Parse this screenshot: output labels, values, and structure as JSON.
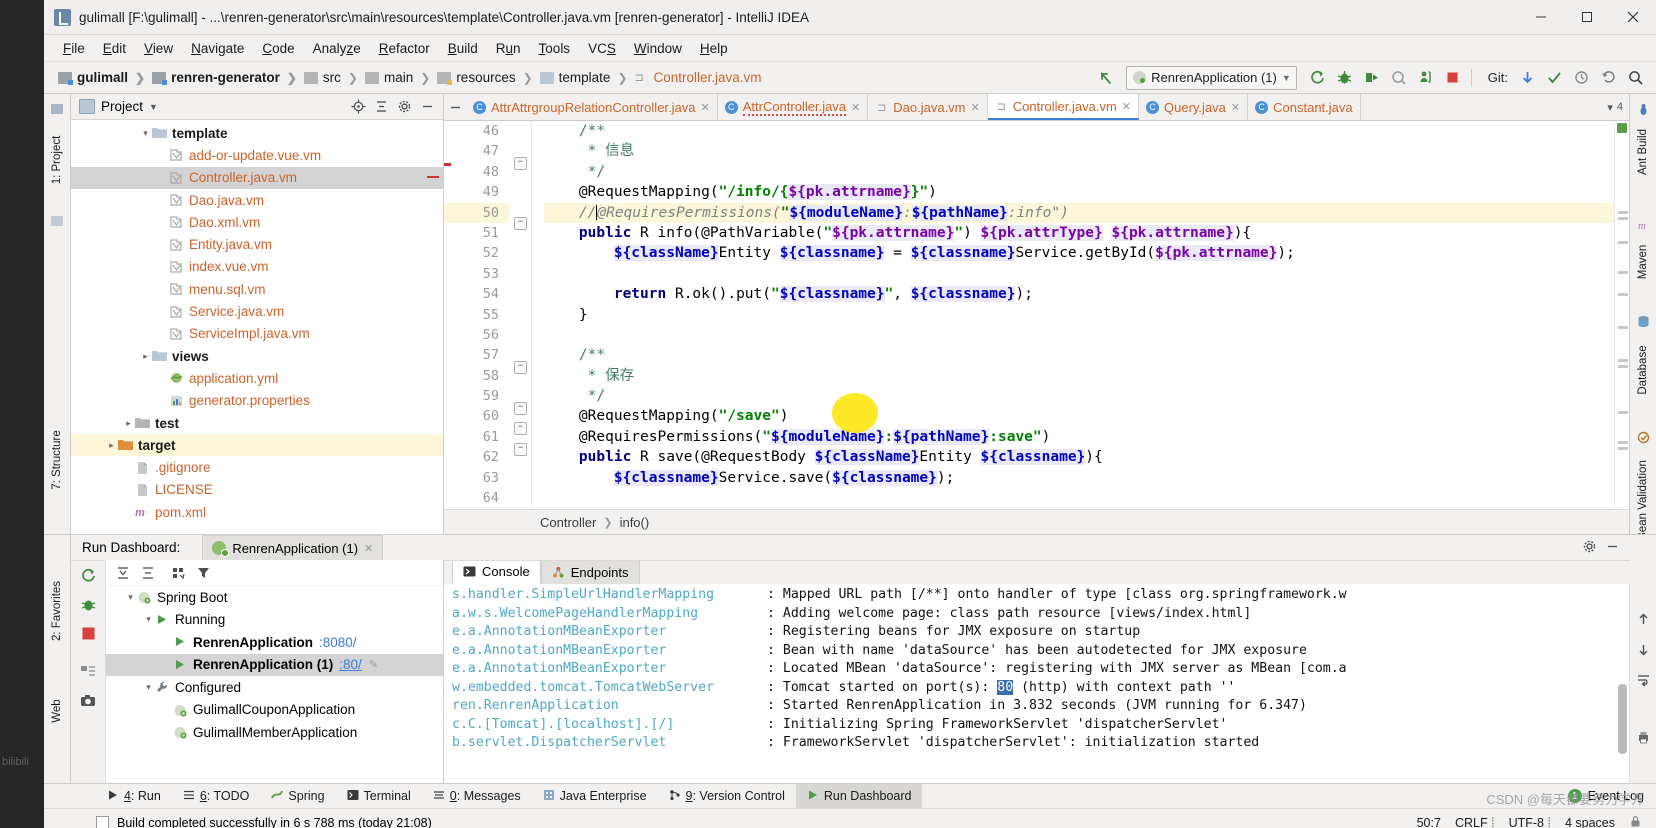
{
  "window": {
    "title": "gulimall [F:\\gulimall] - ...\\renren-generator\\src\\main\\resources\\template\\Controller.java.vm [renren-generator] - IntelliJ IDEA",
    "minimize_label": "Minimize",
    "maximize_label": "Maximize",
    "close_label": "Close"
  },
  "menu": [
    "File",
    "Edit",
    "View",
    "Navigate",
    "Code",
    "Analyze",
    "Refactor",
    "Build",
    "Run",
    "Tools",
    "VCS",
    "Window",
    "Help"
  ],
  "breadcrumbs": [
    {
      "label": "gulimall",
      "icon": "module-icon",
      "bold": true
    },
    {
      "label": "renren-generator",
      "icon": "module-icon",
      "bold": true
    },
    {
      "label": "src",
      "icon": "folder-icon",
      "bold": false
    },
    {
      "label": "main",
      "icon": "folder-icon",
      "bold": false
    },
    {
      "label": "resources",
      "icon": "resources-folder-icon",
      "bold": false
    },
    {
      "label": "template",
      "icon": "folder-icon",
      "bold": false
    },
    {
      "label": "Controller.java.vm",
      "icon": "velocity-file-icon",
      "bold": false
    }
  ],
  "toolbar": {
    "run_config": "RenrenApplication (1)",
    "git_label": "Git:",
    "icons": [
      "back-arrow-icon",
      "rerun-icon",
      "debug-icon",
      "run-with-coverage-icon",
      "profile-icon",
      "attach-icon",
      "stop-icon",
      "update-project-icon",
      "commit-icon",
      "history-icon",
      "rollback-icon",
      "search-everywhere-icon"
    ]
  },
  "project_panel": {
    "title": "Project",
    "actions": [
      "locate-icon",
      "collapse-all-icon",
      "settings-icon",
      "hide-icon"
    ],
    "tree": [
      {
        "label": "template",
        "indent": 4,
        "icon": "folder-template-icon",
        "arrow": "down",
        "color": "dark"
      },
      {
        "label": "add-or-update.vue.vm",
        "indent": 5,
        "icon": "velocity-file-icon",
        "arrow": "",
        "color": "orange"
      },
      {
        "label": "Controller.java.vm",
        "indent": 5,
        "icon": "velocity-file-icon",
        "arrow": "",
        "color": "orange",
        "selected": true
      },
      {
        "label": "Dao.java.vm",
        "indent": 5,
        "icon": "velocity-file-icon",
        "arrow": "",
        "color": "orange"
      },
      {
        "label": "Dao.xml.vm",
        "indent": 5,
        "icon": "velocity-file-icon",
        "arrow": "",
        "color": "orange"
      },
      {
        "label": "Entity.java.vm",
        "indent": 5,
        "icon": "velocity-file-icon",
        "arrow": "",
        "color": "orange"
      },
      {
        "label": "index.vue.vm",
        "indent": 5,
        "icon": "velocity-file-icon",
        "arrow": "",
        "color": "orange"
      },
      {
        "label": "menu.sql.vm",
        "indent": 5,
        "icon": "velocity-file-icon",
        "arrow": "",
        "color": "orange"
      },
      {
        "label": "Service.java.vm",
        "indent": 5,
        "icon": "velocity-file-icon",
        "arrow": "",
        "color": "orange"
      },
      {
        "label": "ServiceImpl.java.vm",
        "indent": 5,
        "icon": "velocity-file-icon",
        "arrow": "",
        "color": "orange"
      },
      {
        "label": "views",
        "indent": 4,
        "icon": "folder-template-icon",
        "arrow": "right",
        "color": "dark"
      },
      {
        "label": "application.yml",
        "indent": 5,
        "icon": "yaml-file-icon",
        "arrow": "",
        "color": "orange"
      },
      {
        "label": "generator.properties",
        "indent": 5,
        "icon": "properties-file-icon",
        "arrow": "",
        "color": "orange"
      },
      {
        "label": "test",
        "indent": 3,
        "icon": "folder-icon",
        "arrow": "right",
        "color": "dark"
      },
      {
        "label": "target",
        "indent": 2,
        "icon": "folder-orange-icon",
        "arrow": "right",
        "color": "dark",
        "highlight": true
      },
      {
        "label": ".gitignore",
        "indent": 3,
        "icon": "git-file-icon",
        "arrow": "",
        "color": "orange"
      },
      {
        "label": "LICENSE",
        "indent": 3,
        "icon": "git-file-icon",
        "arrow": "",
        "color": "orange"
      },
      {
        "label": "pom.xml",
        "indent": 3,
        "icon": "maven-file-icon",
        "arrow": "",
        "color": "orange"
      }
    ]
  },
  "editor_tabs": [
    {
      "label": "AttrAttrgroupRelationController.java",
      "icon": "java-class-icon",
      "active": false,
      "closable": true
    },
    {
      "label": "AttrController.java",
      "icon": "java-class-icon",
      "active": false,
      "closable": true,
      "error": true
    },
    {
      "label": "Dao.java.vm",
      "icon": "velocity-file-icon",
      "active": false,
      "closable": true
    },
    {
      "label": "Controller.java.vm",
      "icon": "velocity-file-icon",
      "active": true,
      "closable": true
    },
    {
      "label": "Query.java",
      "icon": "java-class-icon",
      "active": false,
      "closable": true
    },
    {
      "label": "Constant.java",
      "icon": "java-class-icon",
      "active": false,
      "closable": false
    }
  ],
  "tab_overflow": "4",
  "code": {
    "first_line": 46,
    "highlight_line": 50,
    "lines": [
      {
        "n": 46,
        "html": "    <span class=\"cmt2\">/**</span>"
      },
      {
        "n": 47,
        "html": "     <span class=\"cmt2\">* 信息</span>"
      },
      {
        "n": 48,
        "html": "     <span class=\"cmt2\">*/</span>"
      },
      {
        "n": 49,
        "html": "    <span class=\"pl\">@RequestMapping(</span><span class=\"str\">\"/info/{</span><span class=\"varp\">${pk.attrname}</span><span class=\"str\">}\"</span><span class=\"pl\">)</span>"
      },
      {
        "n": 50,
        "html": "    <span class=\"cmt\">//</span><span class=\"caret\"></span><span class=\"cmt\">@RequiresPermissions(</span><span class=\"str\">\"</span><span class=\"var\">${moduleName}</span><span class=\"cmt\">:</span><span class=\"var\">${pathName}</span><span class=\"cmt\">:info\"</span><span class=\"cmt\">)</span>"
      },
      {
        "n": 51,
        "html": "    <span class=\"kw\">public</span> <span class=\"pl\">R info(@PathVariable(</span><span class=\"str\">\"</span><span class=\"varp\">${pk.attrname}</span><span class=\"str\">\"</span><span class=\"pl\">) </span><span class=\"varp\">${pk.attrType}</span><span class=\"pl\"> </span><span class=\"varp\">${pk.attrname}</span><span class=\"pl\">){</span>"
      },
      {
        "n": 52,
        "html": "        <span class=\"var\">${className}</span><span class=\"pl\">Entity </span><span class=\"var\">${classname}</span><span class=\"pl\"> = </span><span class=\"var\">${classname}</span><span class=\"pl\">Service.getById(</span><span class=\"varp\">${pk.attrname}</span><span class=\"pl\">);</span>"
      },
      {
        "n": 53,
        "html": ""
      },
      {
        "n": 54,
        "html": "        <span class=\"kw\">return</span> <span class=\"pl\">R.ok().put(</span><span class=\"str\">\"</span><span class=\"var\">${classname}</span><span class=\"str\">\"</span><span class=\"pl\">, </span><span class=\"var\">${classname}</span><span class=\"pl\">);</span>"
      },
      {
        "n": 55,
        "html": "    <span class=\"pl\">}</span>"
      },
      {
        "n": 56,
        "html": ""
      },
      {
        "n": 57,
        "html": "    <span class=\"cmt2\">/**</span>"
      },
      {
        "n": 58,
        "html": "     <span class=\"cmt2\">* 保存</span>"
      },
      {
        "n": 59,
        "html": "     <span class=\"cmt2\">*/</span>"
      },
      {
        "n": 60,
        "html": "    <span class=\"pl\">@RequestMapping(</span><span class=\"str\">\"/save\"</span><span class=\"pl\">)</span>"
      },
      {
        "n": 61,
        "html": "    <span class=\"pl\">@RequiresPermissions(</span><span class=\"str\">\"</span><span class=\"var\">${moduleName}</span><span class=\"str\">:</span><span class=\"var\">${pathName}</span><span class=\"str\">:save\"</span><span class=\"pl\">)</span>"
      },
      {
        "n": 62,
        "html": "    <span class=\"kw\">public</span> <span class=\"pl\">R save(@RequestBody </span><span class=\"var\">${className}</span><span class=\"pl\">Entity </span><span class=\"var\">${classname}</span><span class=\"pl\">){</span>"
      },
      {
        "n": 63,
        "html": "        <span class=\"var\">${classname}</span><span class=\"pl\">Service.save(</span><span class=\"var\">${classname}</span><span class=\"pl\">);</span>"
      },
      {
        "n": 64,
        "html": ""
      }
    ]
  },
  "code_breadcrumb": [
    "Controller",
    "info()"
  ],
  "run_dashboard": {
    "title": "Run Dashboard:",
    "tab": "RenrenApplication (1)",
    "toolbar_icons": [
      "rerun-icon",
      "expand-all-icon",
      "collapse-all-icon",
      "group-icon",
      "filter-icon"
    ],
    "side_icons": [
      "rerun-icon",
      "debug-icon",
      "stop-icon",
      "show-services-icon",
      "screenshot-icon"
    ],
    "tree": [
      {
        "label": "Spring Boot",
        "indent": 1,
        "arrow": "down",
        "icon": "spring-boot-icon"
      },
      {
        "label": "Running",
        "indent": 2,
        "arrow": "down",
        "icon": "running-icon"
      },
      {
        "label": "RenrenApplication",
        "port": ":8080/",
        "indent": 3,
        "arrow": "",
        "icon": "run-icon",
        "bold": true
      },
      {
        "label": "RenrenApplication (1)",
        "port": ":80/",
        "indent": 3,
        "arrow": "",
        "icon": "run-icon",
        "bold": true,
        "selected": true,
        "edit": true
      },
      {
        "label": "Configured",
        "indent": 2,
        "arrow": "down",
        "icon": "wrench-icon"
      },
      {
        "label": "GulimallCouponApplication",
        "indent": 3,
        "arrow": "",
        "icon": "spring-boot-icon"
      },
      {
        "label": "GulimallMemberApplication",
        "indent": 3,
        "arrow": "",
        "icon": "spring-boot-icon"
      }
    ]
  },
  "console": {
    "tabs": [
      {
        "label": "Console",
        "icon": "console-icon",
        "active": true
      },
      {
        "label": "Endpoints",
        "icon": "endpoints-icon",
        "active": false
      }
    ],
    "lines": [
      {
        "cls": "s.handler.SimpleUrlHandlerMapping",
        "msg": ": Mapped URL path [/**] onto handler of type [class org.springframework.w"
      },
      {
        "cls": "a.w.s.WelcomePageHandlerMapping",
        "msg": ": Adding welcome page: class path resource [views/index.html]"
      },
      {
        "cls": "e.a.AnnotationMBeanExporter",
        "msg": ": Registering beans for JMX exposure on startup"
      },
      {
        "cls": "e.a.AnnotationMBeanExporter",
        "msg": ": Bean with name 'dataSource' has been autodetected for JMX exposure"
      },
      {
        "cls": "e.a.AnnotationMBeanExporter",
        "msg": ": Located MBean 'dataSource': registering with JMX server as MBean [com.a"
      },
      {
        "cls": "w.embedded.tomcat.TomcatWebServer",
        "msg": ": Tomcat started on port(s): 80 (http) with context path ''",
        "highlight": "80"
      },
      {
        "cls": "ren.RenrenApplication",
        "msg": ": Started RenrenApplication in 3.832 seconds (JVM running for 6.347)"
      },
      {
        "cls": "c.C.[Tomcat].[localhost].[/]",
        "msg": ": Initializing Spring FrameworkServlet 'dispatcherServlet'"
      },
      {
        "cls": "b.servlet.DispatcherServlet",
        "msg": ": FrameworkServlet 'dispatcherServlet': initialization started"
      }
    ]
  },
  "tool_windows": [
    {
      "label": "4: Run",
      "underline": "4",
      "icon": "run-icon",
      "active": false
    },
    {
      "label": "6: TODO",
      "underline": "6",
      "icon": "todo-icon",
      "active": false
    },
    {
      "label": "Spring",
      "underline": "",
      "icon": "spring-icon",
      "active": false
    },
    {
      "label": "Terminal",
      "underline": "",
      "icon": "terminal-icon",
      "active": false
    },
    {
      "label": "0: Messages",
      "underline": "0",
      "icon": "messages-icon",
      "active": false
    },
    {
      "label": "Java Enterprise",
      "underline": "",
      "icon": "java-enterprise-icon",
      "active": false
    },
    {
      "label": "9: Version Control",
      "underline": "9",
      "icon": "version-control-icon",
      "active": false
    },
    {
      "label": "Run Dashboard",
      "underline": "",
      "icon": "run-dashboard-icon",
      "active": true
    }
  ],
  "event_log": {
    "label": "Event Log",
    "count": "1"
  },
  "status": {
    "build_message": "Build completed successfully in 6 s 788 ms (today 21:08)",
    "caret_position": "50:7",
    "line_separator": "CRLF",
    "encoding": "UTF-8",
    "indent": "4 spaces"
  },
  "right_rail": [
    "Ant Build",
    "Maven",
    "Database",
    "Bean Validation"
  ],
  "left_rail": [
    "1: Project",
    "7: Structure",
    "2: Favorites",
    "Web"
  ],
  "watermarks": {
    "bottom_right": "CSDN @每天都要努力学开",
    "bottom_left": "bilibili"
  }
}
